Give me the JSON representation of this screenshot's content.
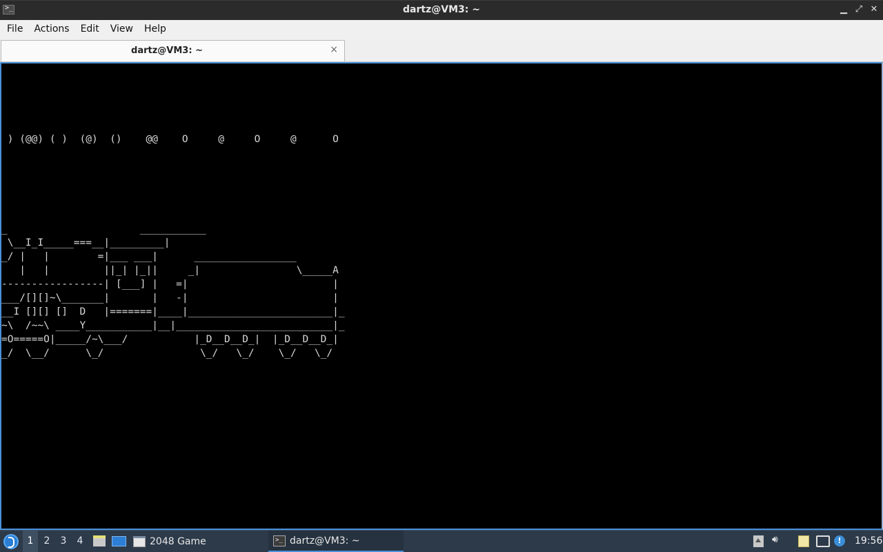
{
  "window": {
    "title": "dartz@VM3: ~",
    "app_icon": "terminal-icon",
    "buttons": [
      "minimize-icon",
      "maximize-icon",
      "close-icon"
    ]
  },
  "menu": {
    "items": [
      "File",
      "Actions",
      "Edit",
      "View",
      "Help"
    ]
  },
  "tab": {
    "label": "dartz@VM3: ~",
    "close_glyph": "×"
  },
  "terminal": {
    "smoke": " ) (@@) ( )  (@)  ()    @@    O     @     O     @      O",
    "train": "_                      ___________\n \\__I_I_____===__|_________|\n_/ |   |        =|___ ___|      _________________\n   |   |         ||_| |_||     _|                \\_____A\n-----------------| [___] |   =|                        |\n___/[][]~\\_______|       |   -|                        |\n__I [][] []  D   |=======|____|________________________|_\n~\\  /~~\\ ____Y___________|__|__________________________|_\n=O=====O|_____/~\\___/           |_D__D__D_|  |_D__D__D_|\n_/  \\__/      \\_/                \\_/   \\_/    \\_/   \\_/"
  },
  "taskbar": {
    "start_icon": "lxqt-start-icon",
    "desktops": [
      "1",
      "2",
      "3",
      "4"
    ],
    "active_desktop": "1",
    "quicklaunch": [
      "file-manager-icon",
      "show-desktop-icon"
    ],
    "tasks": [
      {
        "label": "2048 Game",
        "icon": "window-icon"
      },
      {
        "label": "dartz@VM3: ~",
        "icon": "terminal-icon",
        "active": true
      }
    ],
    "tray": [
      "tray-expand-icon",
      "volume-icon",
      "clipboard-icon",
      "network-icon",
      "update-notifier-icon"
    ],
    "clock": "19:56"
  },
  "colors": {
    "terminal_bg": "#000000",
    "terminal_fg": "#d8d8d8",
    "titlebar_bg": "#2b2b2b",
    "taskbar_bg": "#2d3a4a",
    "focus_border": "#4a90d9"
  }
}
